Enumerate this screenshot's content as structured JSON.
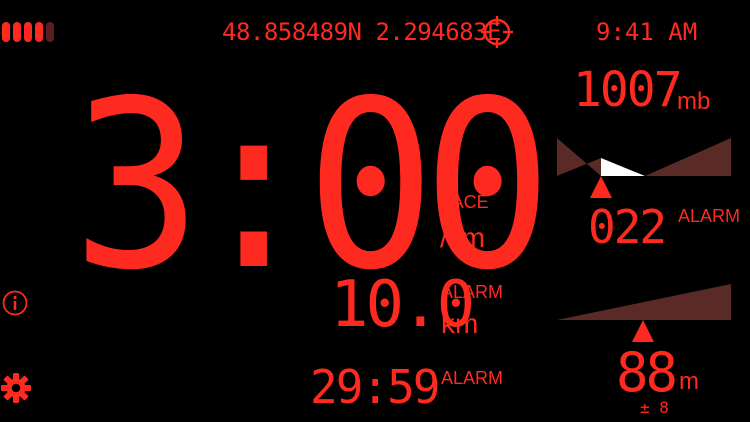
{
  "battery": {
    "segments_on": 4,
    "segments_total": 5,
    "icon": "battery-level-icon",
    "color_on": "#ff2a1f",
    "color_off": "#5a1e1c"
  },
  "status_bar": {
    "coordinates": "48.858489N 2.294683E",
    "target_icon": "crosshair-target-icon",
    "time": "9:41 AM"
  },
  "pace": {
    "value": "3:00",
    "label": "PACE",
    "unit": "/km"
  },
  "distance": {
    "value": "10.0",
    "alarm_label": "ALARM",
    "unit": "km"
  },
  "elapsed": {
    "value": "29:59",
    "alarm_label": "ALARM"
  },
  "pressure": {
    "value": "1007",
    "unit": "mb",
    "alarm_value": "022",
    "alarm_label": "ALARM"
  },
  "altitude": {
    "value": "88",
    "unit": "m",
    "accuracy": "± 8"
  },
  "buttons": {
    "info_icon": "info-icon",
    "settings_icon": "gear-icon"
  },
  "colors": {
    "accent": "#ff2a1f",
    "gauge_fill": "#5a2a26",
    "gauge_highlight": "#ffffff",
    "background": "#000000"
  }
}
